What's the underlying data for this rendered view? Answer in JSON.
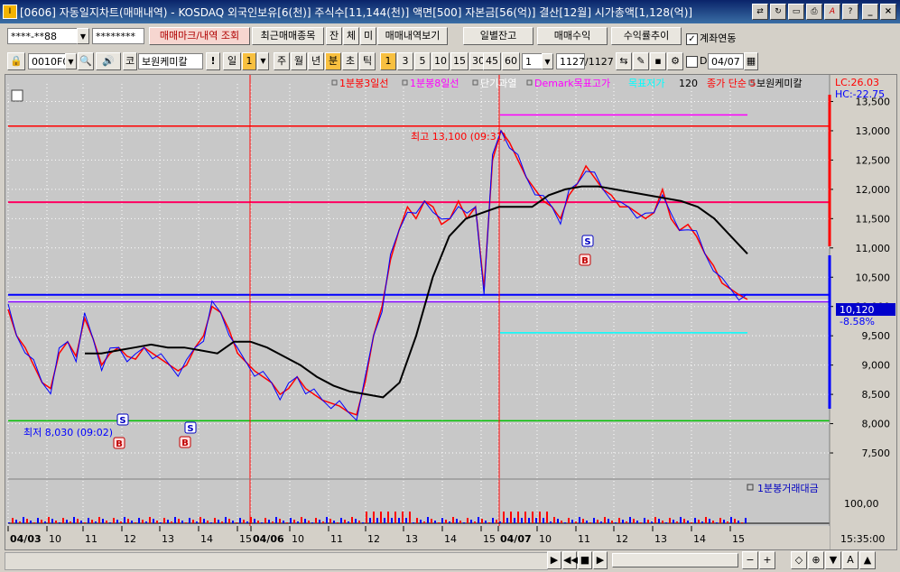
{
  "window": {
    "title": "[0606] 자동일지차트(매매내역) - KOSDAQ 외국인보유[6(천)] 주식수[11,144(천)] 액면[500] 자본금[56(억)] 결산[12월] 시가총액[1,128(억)]"
  },
  "toolbar1": {
    "account": "****-**88",
    "password": "********",
    "buttons": [
      "매매마크/내역 조회",
      "최근매매종목",
      "잔",
      "체",
      "미",
      "매매내역보기"
    ],
    "right_buttons": [
      "일별잔고",
      "매매수익",
      "수익률추이"
    ],
    "link_label": "계좌연동",
    "link_checked": "✓"
  },
  "toolbar2": {
    "code": "0010F0",
    "market_prefix": "코",
    "stock_name": "보원케미칼",
    "period_buttons": [
      "일",
      "1",
      "주",
      "월",
      "년",
      "분",
      "초",
      "틱"
    ],
    "interval_buttons": [
      "1",
      "3",
      "5",
      "10",
      "15",
      "30",
      "45",
      "60"
    ],
    "interval_select": "1",
    "count": "1127",
    "count_total": "/1127",
    "d_label": "D",
    "date": "04/07"
  },
  "chart": {
    "legend": [
      "1분봉3일선",
      "1분봉8일선",
      "단기과열",
      "Demark목표고가",
      "목표저가",
      "120",
      "종가 단순 5",
      "보원케미칼"
    ],
    "legend_colors": [
      "#ff0000",
      "#ff00ff",
      "#ffffff",
      "#ff00ff",
      "#00ffff",
      "#000000",
      "#ff0000",
      "#000000"
    ],
    "lc_label": "LC:26.03",
    "hc_label": "HC:-22.75",
    "high_label": "최고 13,100 (09:31)",
    "low_label": "최저 8,030 (09:02)",
    "current_price": "10,120",
    "current_change": "-8.58%",
    "volume_legend": "1분봉거래대금",
    "volume_tick": "100,00",
    "time_label": "15:35:00",
    "marker_s": "S",
    "marker_b": "B",
    "x_ticks": [
      "04/03",
      "10",
      "11",
      "12",
      "13",
      "14",
      "15",
      "04/06",
      "10",
      "11",
      "12",
      "13",
      "14",
      "15",
      "04/07",
      "10",
      "11",
      "12",
      "13",
      "14",
      "15"
    ]
  },
  "chart_data": {
    "type": "line",
    "title": "",
    "xlabel": "",
    "ylabel": "",
    "ylim": [
      7100,
      13800
    ],
    "yticks": [
      7500,
      8000,
      8500,
      9000,
      9500,
      10000,
      10500,
      11000,
      11500,
      12000,
      12500,
      13000,
      13500
    ],
    "series": [
      {
        "name": "보원케미칼",
        "color": "#ff0000",
        "values": [
          9950,
          9500,
          9300,
          9000,
          8700,
          8600,
          9200,
          9400,
          9150,
          9800,
          9450,
          9000,
          9200,
          9300,
          9150,
          9100,
          9300,
          9200,
          9100,
          9000,
          8900,
          9000,
          9300,
          9500,
          10000,
          9900,
          9600,
          9200,
          9050,
          8900,
          8800,
          8700,
          8500,
          8600,
          8800,
          8600,
          8500,
          8400,
          8350,
          8300,
          8200,
          8150,
          8700,
          9500,
          10000,
          10800,
          11300,
          11700,
          11500,
          11800,
          11700,
          11400,
          11500,
          11800,
          11500,
          11700,
          10300,
          12500,
          13000,
          12800,
          12500,
          12200,
          12000,
          11800,
          11700,
          11500,
          11900,
          12100,
          12400,
          12200,
          12000,
          11900,
          11700,
          11700,
          11600,
          11500,
          11600,
          12000,
          11500,
          11300,
          11400,
          11200,
          10900,
          10700,
          10400,
          10300,
          10200,
          10120
        ]
      },
      {
        "name": "120",
        "color": "#000000",
        "values": [
          9200,
          9200,
          9250,
          9300,
          9350,
          9300,
          9300,
          9250,
          9200,
          9400,
          9400,
          9300,
          9150,
          9000,
          8800,
          8650,
          8550,
          8500,
          8450,
          8700,
          9500,
          10500,
          11200,
          11500,
          11600,
          11700,
          11700,
          11700,
          11900,
          12000,
          12050,
          12050,
          12000,
          11950,
          11900,
          11850,
          11800,
          11700,
          11500,
          11200,
          10900
        ]
      }
    ],
    "annotations": {
      "high": 13100,
      "low": 8030,
      "current": 10120,
      "lines": [
        {
          "value": 13270,
          "color": "#ff00ff"
        },
        {
          "value": 13080,
          "color": "#ff0000"
        },
        {
          "value": 11780,
          "color": "#ff0060"
        },
        {
          "value": 10200,
          "color": "#0000ff"
        },
        {
          "value": 10100,
          "color": "#ffffff"
        },
        {
          "value": 10080,
          "color": "#8000ff"
        },
        {
          "value": 9550,
          "color": "#00ffff"
        },
        {
          "value": 8050,
          "color": "#00c000"
        }
      ]
    },
    "grid": true,
    "legend_position": "top"
  }
}
